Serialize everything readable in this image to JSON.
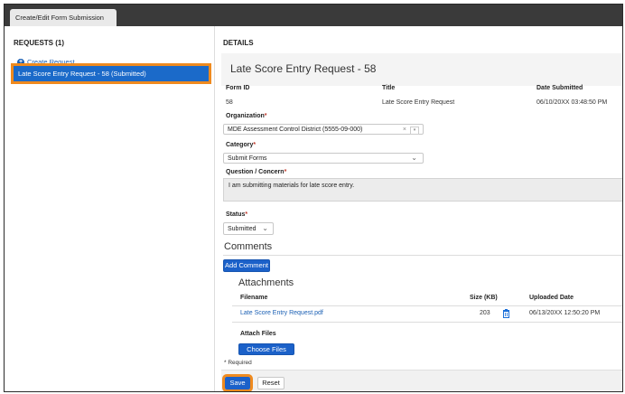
{
  "tab": {
    "label": "Create/Edit Form Submission"
  },
  "requests": {
    "heading": "REQUESTS (1)",
    "create_label": "Create Request",
    "items": [
      {
        "label": "Late Score Entry Request - 58 (Submitted)"
      }
    ]
  },
  "details": {
    "heading": "DETAILS",
    "title": "Late Score Entry Request - 58",
    "form_id_label": "Form ID",
    "form_id": "58",
    "title_label": "Title",
    "title_value": "Late Score Entry Request",
    "date_label": "Date Submitted",
    "date_value": "06/10/20XX 03:48:50 PM",
    "organization_label": "Organization",
    "organization_value": "MDE Assessment Control District (5555-09-000)",
    "category_label": "Category",
    "category_value": "Submit Forms",
    "question_label": "Question / Concern",
    "question_value": "I am submitting materials for late score entry.",
    "status_label": "Status",
    "status_value": "Submitted",
    "required_marker": "*"
  },
  "comments": {
    "heading": "Comments",
    "add_label": "Add Comment"
  },
  "attachments": {
    "heading": "Attachments",
    "columns": {
      "filename": "Filename",
      "size": "Size (KB)",
      "uploaded": "Uploaded Date"
    },
    "rows": [
      {
        "filename": "Late Score Entry Request.pdf",
        "size": "203",
        "uploaded": "06/13/20XX 12:50:20 PM"
      }
    ],
    "attach_label": "Attach Files",
    "choose_label": "Choose Files"
  },
  "footer": {
    "required_note": "* Required",
    "save_label": "Save",
    "reset_label": "Reset"
  },
  "colors": {
    "accent": "#1b61c9",
    "highlight": "#ef8a1e",
    "required": "#c0392b"
  }
}
